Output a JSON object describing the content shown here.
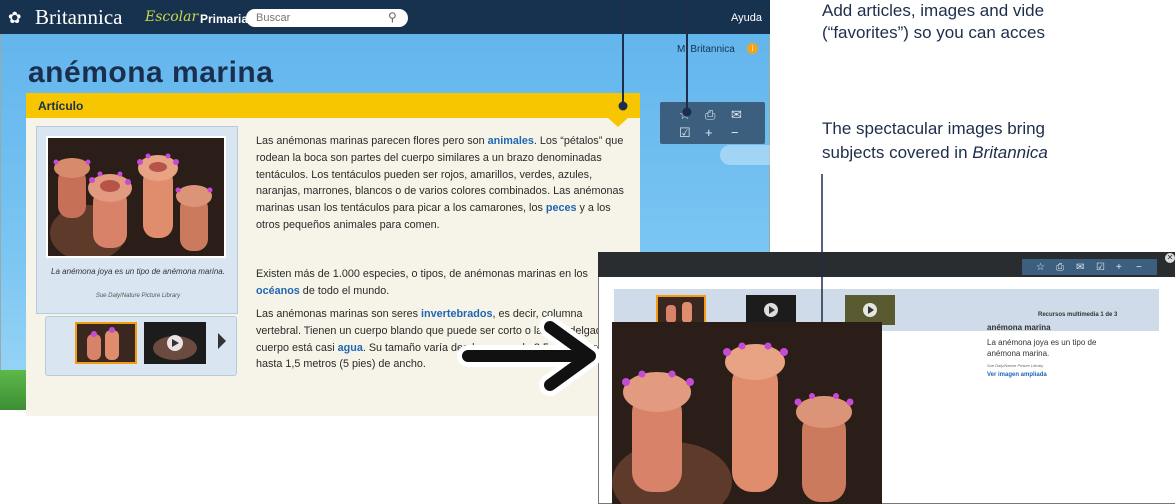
{
  "header": {
    "logo_text": "Britannica",
    "logo_escolar": "Escolar",
    "level": "Primaria",
    "search_placeholder": "Buscar",
    "help": "Ayuda",
    "mi_britannica": "Mi Britannica"
  },
  "page": {
    "title": "anémona marina",
    "tab_label": "Artículo"
  },
  "media": {
    "caption": "La anémona joya es un tipo de anémona marina.",
    "credit": "Sue Daly/Nature Picture Library"
  },
  "article": {
    "p1": [
      "Las anémonas marinas parecen flores pero son ",
      "animales",
      ". Los “pétalos” que rodean la boca son partes del cuerpo similares a un brazo denominadas tentáculos. Los tentáculos pueden ser rojos, amarillos, verdes, azules, naranjas, marrones, blancos o de varios colores combinados. Las anémonas marinas usan los tentáculos para picar a los camarones, los ",
      "peces",
      " y a los otros pequeños animales para comen."
    ],
    "p2": [
      "Existen más de 1.000 especies, o tipos, de anémonas marinas en los ",
      "océanos",
      " de todo el mundo."
    ],
    "p3": [
      "Las anémonas marinas son seres ",
      "invertebrados",
      ", es decir, columna vertebral. Tienen un cuerpo blando que puede ser corto o largo y delgado. El cuerpo está casi ",
      "agua",
      ". Su tamaño varía desde menos de 2,5 centímetros hasta 1,5 metros (5 pies) de ancho."
    ]
  },
  "lightbox": {
    "counter": "Recursos multimedia 1 de 3",
    "title": "anémona marina",
    "caption": "La anémona joya es un tipo de anémona marina.",
    "credit": "Sue Daly/Nature Picture Library",
    "link": "Ver imagen ampliada"
  },
  "annotations": {
    "line1": "Add articles, images and vide",
    "line2": "(“favorites”) so you can acces",
    "line3": "The spectacular images bring",
    "line4_prefix": "subjects covered in ",
    "line4_italic": "Britannica"
  },
  "colors": {
    "nav": "#17324f",
    "tab": "#f7c600",
    "link": "#1f66b3",
    "annotation": "#1d2e4a"
  }
}
